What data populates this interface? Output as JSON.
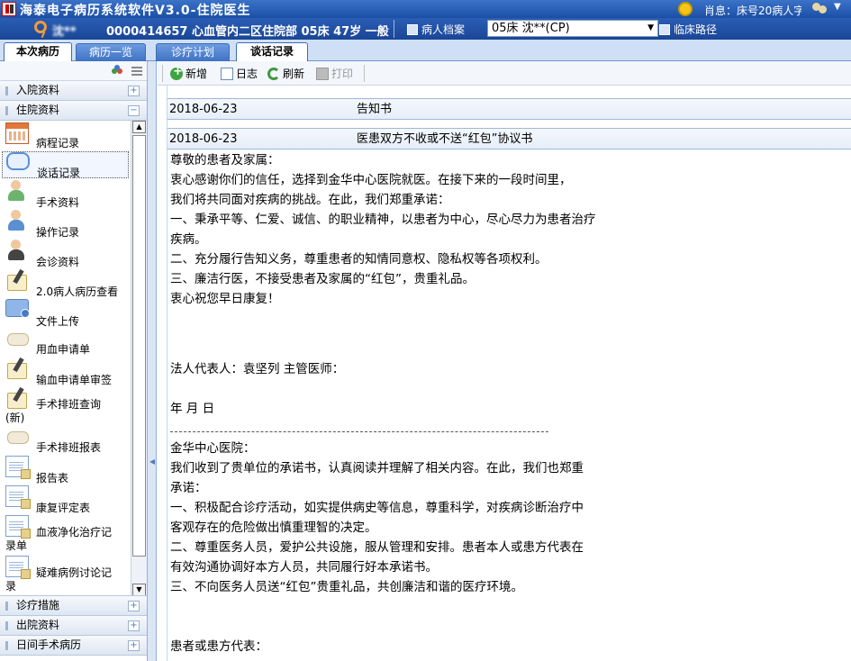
{
  "titlebar": {
    "title": "海泰电子病历系统软件V3.0-住院医生",
    "message": "肖息：床号20病人字"
  },
  "patient": {
    "name": "沈**",
    "info": "0000414657 心血管内二区住院部 05床 47岁 一般",
    "record_btn": "病人档案",
    "select_value": "05床 沈**(CP)",
    "path_btn": "临床路径"
  },
  "tabs": [
    "本次病历",
    "病历一览",
    "诊疗计划",
    "谈话记录"
  ],
  "sidebar": {
    "groups_top": [
      "入院资料",
      "住院资料"
    ],
    "items": [
      {
        "label": "病程记录",
        "icon": "calendar-icon"
      },
      {
        "label": "谈话记录",
        "icon": "speech-bubble-icon"
      },
      {
        "label": "手术资料",
        "icon": "surgeon-icon"
      },
      {
        "label": "操作记录",
        "icon": "operation-icon"
      },
      {
        "label": "会诊资料",
        "icon": "consult-icon"
      },
      {
        "label": "2.0病人病历查看",
        "icon": "edit-record-icon"
      },
      {
        "label": "文件上传",
        "icon": "folder-upload-icon"
      },
      {
        "label": "用血申请单",
        "icon": "blood-request-icon"
      },
      {
        "label": "输血申请单审签",
        "icon": "transfusion-sign-icon"
      },
      {
        "label": "手术排班查询",
        "label2": "(新)",
        "icon": "surgery-schedule-icon"
      },
      {
        "label": "手术排班报表",
        "icon": "schedule-report-icon"
      },
      {
        "label": "报告表",
        "icon": "report-icon"
      },
      {
        "label": "康复评定表",
        "icon": "rehab-icon"
      },
      {
        "label": "血液净化治疗记",
        "label2": "录单",
        "icon": "dialysis-icon"
      },
      {
        "label": "疑难病例讨论记",
        "label2": "录",
        "icon": "case-discussion-icon"
      }
    ],
    "groups_bottom": [
      "诊疗措施",
      "出院资料",
      "日间手术病历"
    ]
  },
  "toolbar": {
    "add": "新增",
    "log": "日志",
    "refresh": "刷新",
    "print": "打印"
  },
  "records": [
    {
      "date": "2018-06-23",
      "title": "告知书"
    },
    {
      "date": "2018-06-23",
      "title": "医患双方不收或不送“红包”协议书"
    }
  ],
  "document": {
    "lines": [
      "尊敬的患者及家属：",
      "衷心感谢你们的信任，选择到金华中心医院就医。在接下来的一段时间里，",
      "我们将共同面对疾病的挑战。在此，我们郑重承诺：",
      "一、秉承平等、仁爱、诚信、的职业精神，以患者为中心，尽心尽力为患者治疗",
      "疾病。",
      "二、充分履行告知义务，尊重患者的知情同意权、隐私权等各项权利。",
      "三、廉洁行医，不接受患者及家属的“红包”，贵重礼品。",
      "衷心祝您早日康复！",
      "法人代表人：袁坚列 主管医师：",
      "年 月 日",
      "金华中心医院：",
      "我们收到了贵单位的承诺书，认真阅读并理解了相关内容。在此，我们也郑重",
      "承诺：",
      "一、积极配合诊疗活动，如实提供病史等信息，尊重科学，对疾病诊断治疗中",
      "客观存在的危险做出慎重理智的决定。",
      "二、尊重医务人员，爱护公共设施，服从管理和安排。患者本人或患方代表在",
      "有效沟通协调好本方人员，共同履行好本承诺书。",
      "三、不向医务人员送“红包”贵重礼品，共创廉洁和谐的医疗环境。",
      "患者或患方代表："
    ]
  }
}
